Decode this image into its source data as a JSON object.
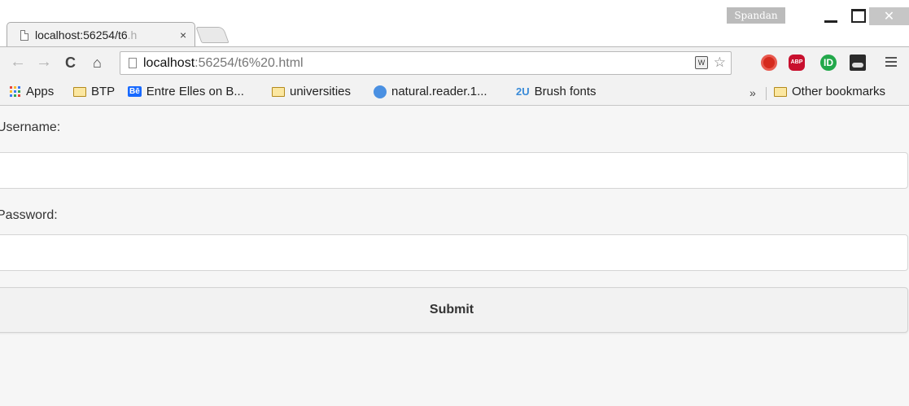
{
  "browser": {
    "tab_title_main": "localhost:56254/t6",
    "tab_title_fade": ".h",
    "tab_close": "×",
    "profile_name": "Spandan",
    "close_glyph": "✕",
    "url_host": "localhost",
    "url_path": ":56254/t6%20.html",
    "ext_abp_label": "ABP",
    "ext_id_label": "ID"
  },
  "bookmarks": {
    "items": [
      {
        "label": "Apps",
        "icon": "apps-grid-icon"
      },
      {
        "label": "BTP",
        "icon": "folder-icon"
      },
      {
        "label": "Entre Elles on B...",
        "icon": "behance-icon",
        "icon_text": "Bē"
      },
      {
        "label": "universities",
        "icon": "folder-icon"
      },
      {
        "label": "natural.reader.1...",
        "icon": "naturalreader-icon"
      },
      {
        "label": "Brush fonts",
        "icon": "2u-icon",
        "icon_text": "2U"
      }
    ],
    "overflow": "»",
    "other": "Other bookmarks"
  },
  "form": {
    "username_label": "Username:",
    "username_value": "",
    "password_label": "Password:",
    "password_value": "",
    "submit_label": "Submit"
  },
  "colors": {
    "page_bg": "#f6f6f6",
    "abp_red": "#c8102e",
    "id_green": "#22a84a",
    "behance_blue": "#1769ff"
  }
}
